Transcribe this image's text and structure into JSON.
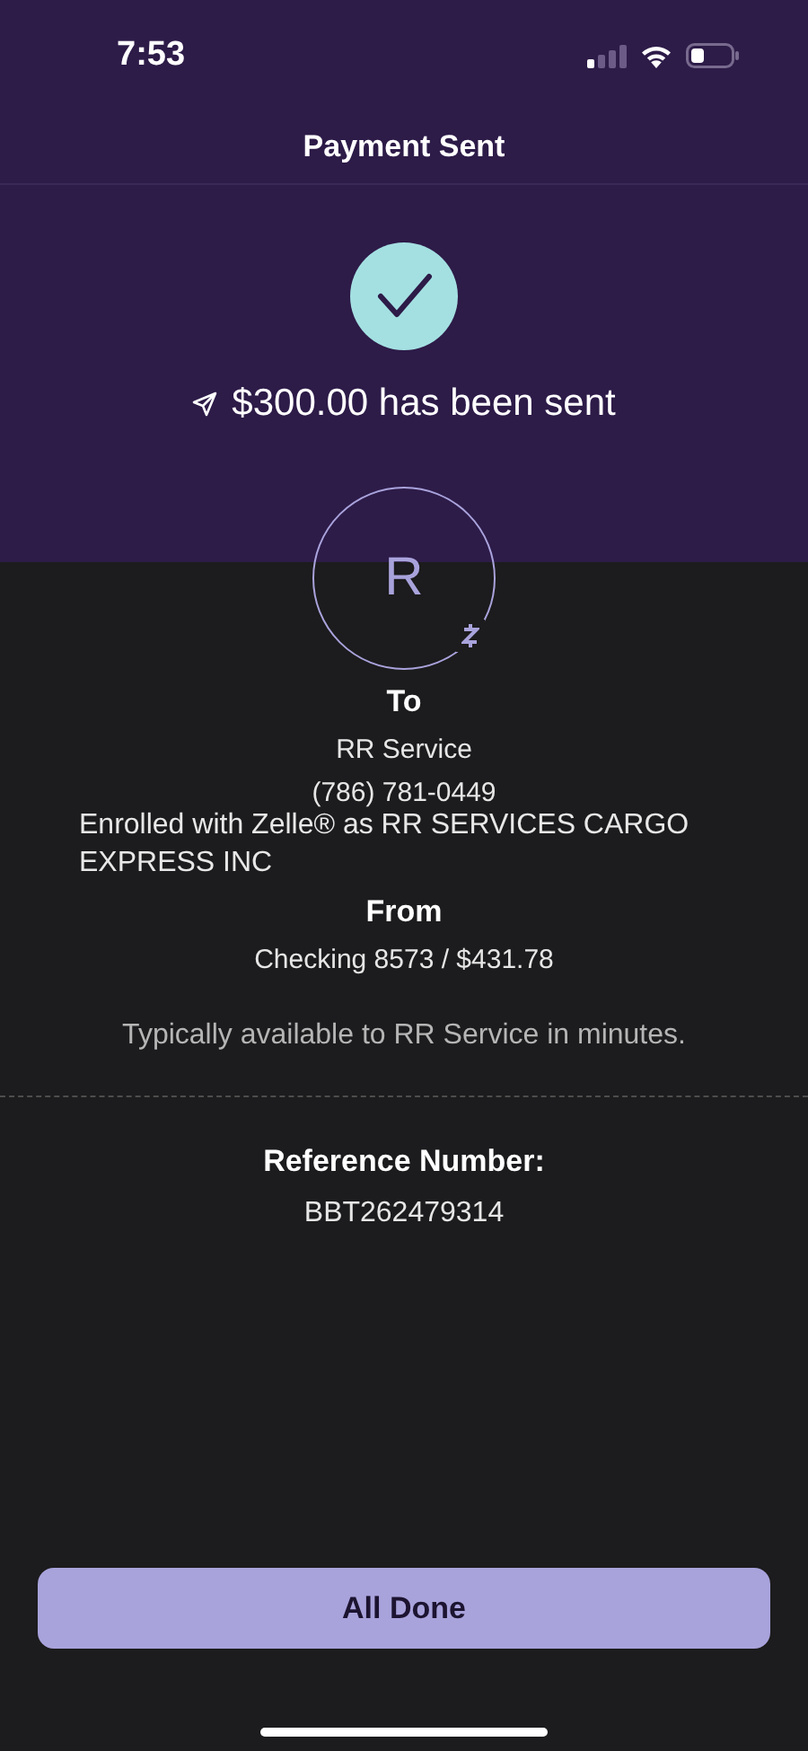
{
  "status_bar": {
    "time": "7:53"
  },
  "header": {
    "title": "Payment Sent"
  },
  "confirmation": {
    "message": "$300.00 has been sent"
  },
  "recipient": {
    "initial": "R",
    "label": "To",
    "name": "RR Service",
    "phone": "(786) 781-0449",
    "enrolled": "Enrolled with Zelle® as RR SERVICES CARGO EXPRESS INC"
  },
  "sender": {
    "label": "From",
    "account": "Checking 8573 / $431.78"
  },
  "availability_note": "Typically available to RR Service in minutes.",
  "reference": {
    "label": "Reference Number:",
    "value": "BBT262479314"
  },
  "buttons": [
    {
      "label": "All Done",
      "kind": "primary"
    }
  ]
}
